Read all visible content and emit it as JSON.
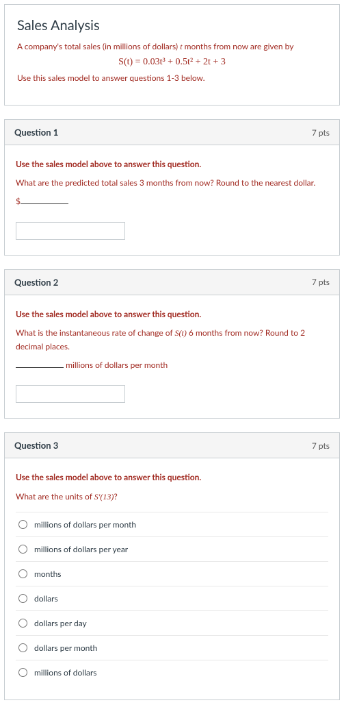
{
  "intro": {
    "title": "Sales Analysis",
    "line1_pre": "A company's total sales (in millions of dollars) ",
    "line1_var": "t",
    "line1_post": " months from now are given by",
    "formula": "S(t) = 0.03t³ + 0.5t² + 2t + 3",
    "line2": "Use this sales model to answer questions 1-3 below."
  },
  "q1": {
    "title": "Question 1",
    "pts": "7 pts",
    "lead": "Use the sales model above to answer this question.",
    "prompt": "What are the predicted total sales 3 months from now?  Round to the nearest dollar.",
    "dollar": "$"
  },
  "q2": {
    "title": "Question 2",
    "pts": "7 pts",
    "lead": "Use the sales model above to answer this question.",
    "prompt_pre": "What is the instantaneous rate of change of ",
    "prompt_fn": "S(t)",
    "prompt_post": " 6 months from now?  Round to 2 decimal places.",
    "unit_text": " millions of dollars per month"
  },
  "q3": {
    "title": "Question 3",
    "pts": "7 pts",
    "lead": "Use the sales model above to answer this question.",
    "prompt_pre": "What are the units of ",
    "prompt_fn": "S′(13)",
    "prompt_post": "?",
    "options": [
      "millions of dollars per month",
      "millions of dollars per year",
      "months",
      "dollars",
      "dollars per day",
      "dollars per month",
      "millions of dollars"
    ]
  }
}
